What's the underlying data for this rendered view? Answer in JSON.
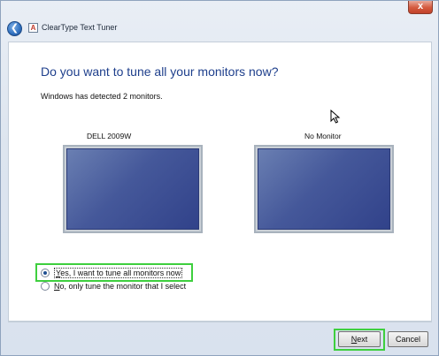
{
  "window": {
    "title": "ClearType Text Tuner",
    "close_label": "x",
    "back_label": "❮",
    "app_icon_label": "A"
  },
  "main": {
    "heading": "Do you want to tune all your monitors now?",
    "detected_text": "Windows has detected 2 monitors."
  },
  "monitors": [
    {
      "label": "DELL 2009W"
    },
    {
      "label": "No Monitor"
    }
  ],
  "options": [
    {
      "label": "Yes, I want to tune all monitors now",
      "checked": true
    },
    {
      "label": "No, only tune the monitor that I select",
      "checked": false
    }
  ],
  "buttons": {
    "next": "Next",
    "cancel": "Cancel"
  },
  "colors": {
    "heading": "#1e3f8c",
    "highlight": "#3ecf3e",
    "screen": "#45589a"
  }
}
